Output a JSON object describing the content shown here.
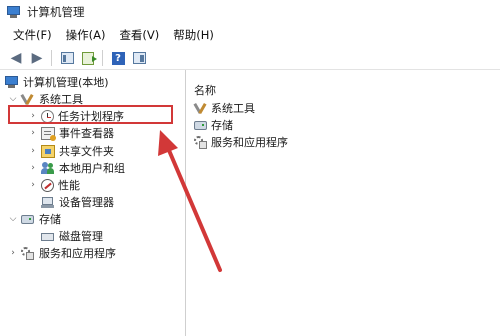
{
  "window": {
    "title": "计算机管理"
  },
  "menu": [
    {
      "id": "file",
      "label": "文件(F)"
    },
    {
      "id": "action",
      "label": "操作(A)"
    },
    {
      "id": "view",
      "label": "查看(V)"
    },
    {
      "id": "help",
      "label": "帮助(H)"
    }
  ],
  "toolbar": {
    "icons": [
      "back-arrow-icon",
      "forward-arrow-icon",
      "show-hide-console-tree-icon",
      "export-list-icon",
      "help-icon",
      "show-hide-action-pane-icon"
    ]
  },
  "tree": {
    "root": {
      "label": "计算机管理(本地)",
      "icon": "computer-management-icon"
    },
    "system_tools": {
      "label": "系统工具",
      "icon": "tools-icon",
      "expanded": true
    },
    "task_scheduler": {
      "label": "任务计划程序",
      "icon": "clock-icon"
    },
    "event_viewer": {
      "label": "事件查看器",
      "icon": "event-viewer-icon"
    },
    "shared_folders": {
      "label": "共享文件夹",
      "icon": "shared-folder-icon"
    },
    "local_users": {
      "label": "本地用户和组",
      "icon": "users-icon"
    },
    "performance": {
      "label": "性能",
      "icon": "performance-icon"
    },
    "device_manager": {
      "label": "设备管理器",
      "icon": "device-manager-icon"
    },
    "storage": {
      "label": "存储",
      "icon": "storage-icon",
      "expanded": true
    },
    "disk_management": {
      "label": "磁盘管理",
      "icon": "disk-icon"
    },
    "services_apps": {
      "label": "服务和应用程序",
      "icon": "services-icon"
    }
  },
  "list": {
    "header": "名称",
    "items": [
      {
        "label": "系统工具",
        "icon": "tools-icon"
      },
      {
        "label": "存储",
        "icon": "storage-icon"
      },
      {
        "label": "服务和应用程序",
        "icon": "services-icon"
      }
    ]
  },
  "annotation": {
    "color": "#d23838"
  }
}
